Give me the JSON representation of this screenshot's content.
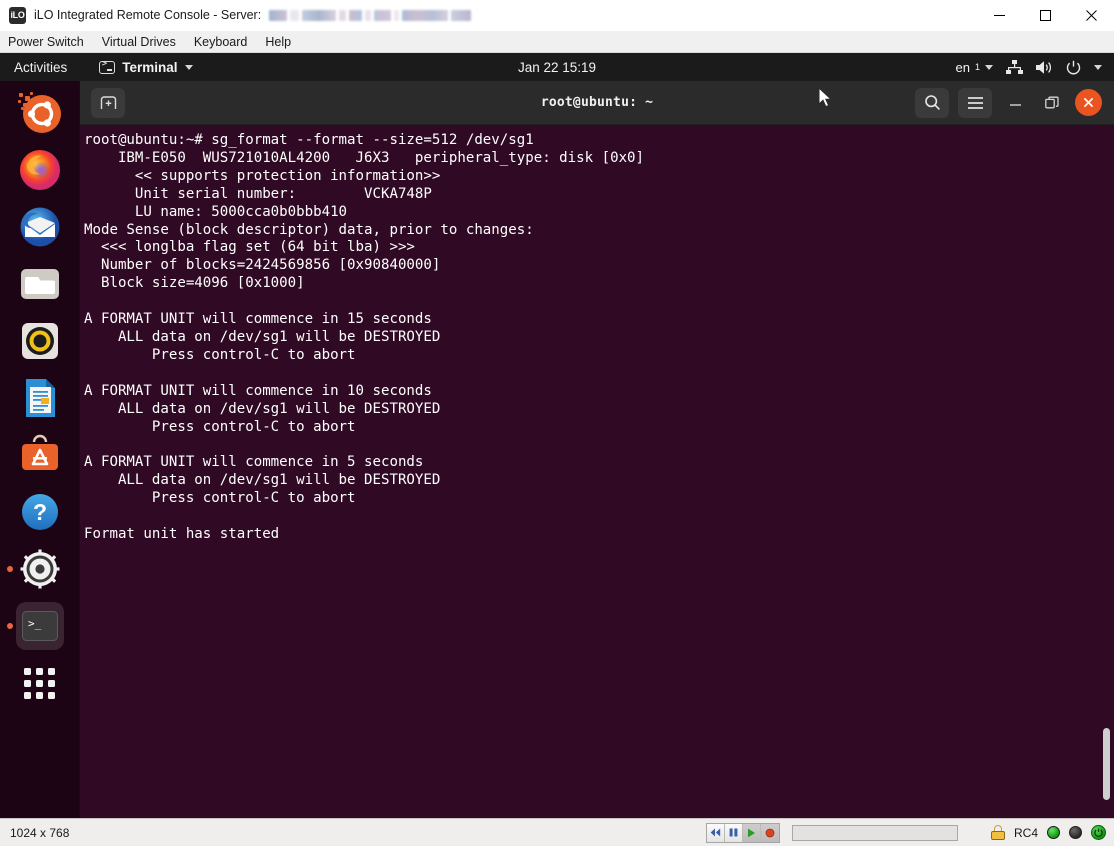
{
  "window": {
    "logo_text": "iLO",
    "title": "iLO Integrated Remote Console - Server:",
    "redacted_server_name": "",
    "controls": {
      "minimize": "minimize-button",
      "maximize": "maximize-button",
      "close": "close-button"
    }
  },
  "menubar": {
    "items": [
      {
        "label": "Power Switch"
      },
      {
        "label": "Virtual Drives"
      },
      {
        "label": "Keyboard"
      },
      {
        "label": "Help"
      }
    ]
  },
  "gnome_panel": {
    "activities": "Activities",
    "app_name": "Terminal",
    "clock": "Jan 22  15:19",
    "keyboard_layout": "en",
    "keyboard_layout_sub": "1",
    "icons": [
      "terminal-icon",
      "chevron-down-icon",
      "network-icon",
      "volume-icon",
      "power-icon",
      "chevron-down-icon"
    ]
  },
  "dock": {
    "items": [
      {
        "name": "ubuntu-logo-icon",
        "label": "Ubuntu",
        "active": false,
        "running": false
      },
      {
        "name": "firefox-icon",
        "label": "Firefox",
        "active": false,
        "running": false
      },
      {
        "name": "thunderbird-icon",
        "label": "Thunderbird",
        "active": false,
        "running": false
      },
      {
        "name": "files-icon",
        "label": "Files",
        "active": false,
        "running": false
      },
      {
        "name": "rhythmbox-icon",
        "label": "Rhythmbox",
        "active": false,
        "running": false
      },
      {
        "name": "libreoffice-writer-icon",
        "label": "LibreOffice Writer",
        "active": false,
        "running": false
      },
      {
        "name": "ubuntu-software-icon",
        "label": "Ubuntu Software",
        "active": false,
        "running": false
      },
      {
        "name": "help-icon",
        "label": "Help",
        "active": false,
        "running": false
      },
      {
        "name": "settings-icon",
        "label": "Settings",
        "active": false,
        "running": true
      },
      {
        "name": "terminal-icon",
        "label": "Terminal",
        "active": true,
        "running": true
      },
      {
        "name": "show-applications-icon",
        "label": "Show Applications",
        "active": false,
        "running": false
      }
    ]
  },
  "terminal": {
    "title": "root@ubuntu: ~",
    "new_tab_label": "+",
    "header_icons": [
      "new-tab-icon",
      "search-icon",
      "hamburger-menu-icon",
      "minimize-icon",
      "restore-icon",
      "close-icon"
    ],
    "background_color": "#300a24",
    "text_color": "#ffffff",
    "output": "root@ubuntu:~# sg_format --format --size=512 /dev/sg1\n    IBM-E050  WUS721010AL4200   J6X3   peripheral_type: disk [0x0]\n      << supports protection information>>\n      Unit serial number:        VCKA748P\n      LU name: 5000cca0b0bbb410\nMode Sense (block descriptor) data, prior to changes:\n  <<< longlba flag set (64 bit lba) >>>\n  Number of blocks=2424569856 [0x90840000]\n  Block size=4096 [0x1000]\n\nA FORMAT UNIT will commence in 15 seconds\n    ALL data on /dev/sg1 will be DESTROYED\n        Press control-C to abort\n\nA FORMAT UNIT will commence in 10 seconds\n    ALL data on /dev/sg1 will be DESTROYED\n        Press control-C to abort\n\nA FORMAT UNIT will commence in 5 seconds\n    ALL data on /dev/sg1 will be DESTROYED\n        Press control-C to abort\n\nFormat unit has started"
  },
  "statusbar": {
    "resolution": "1024 x 768",
    "media_controls": [
      {
        "name": "rewind-button",
        "glyph": "rewind"
      },
      {
        "name": "pause-button",
        "glyph": "pause"
      },
      {
        "name": "play-button",
        "glyph": "play"
      },
      {
        "name": "record-button",
        "glyph": "record"
      }
    ],
    "progress_value": 0,
    "encryption_label": "RC4",
    "lock_icon": "lock-icon",
    "indicators": [
      {
        "name": "status-led-green",
        "color": "#16a516"
      },
      {
        "name": "status-led-inactive",
        "color": "#3a3a3a"
      },
      {
        "name": "power-status-led",
        "color": "#19a81a"
      }
    ]
  },
  "colors": {
    "ubuntu_orange": "#e95420",
    "terminal_bg": "#300a24",
    "panel_dark": "#1b1b1b",
    "header_gray": "#2b2b2b"
  }
}
